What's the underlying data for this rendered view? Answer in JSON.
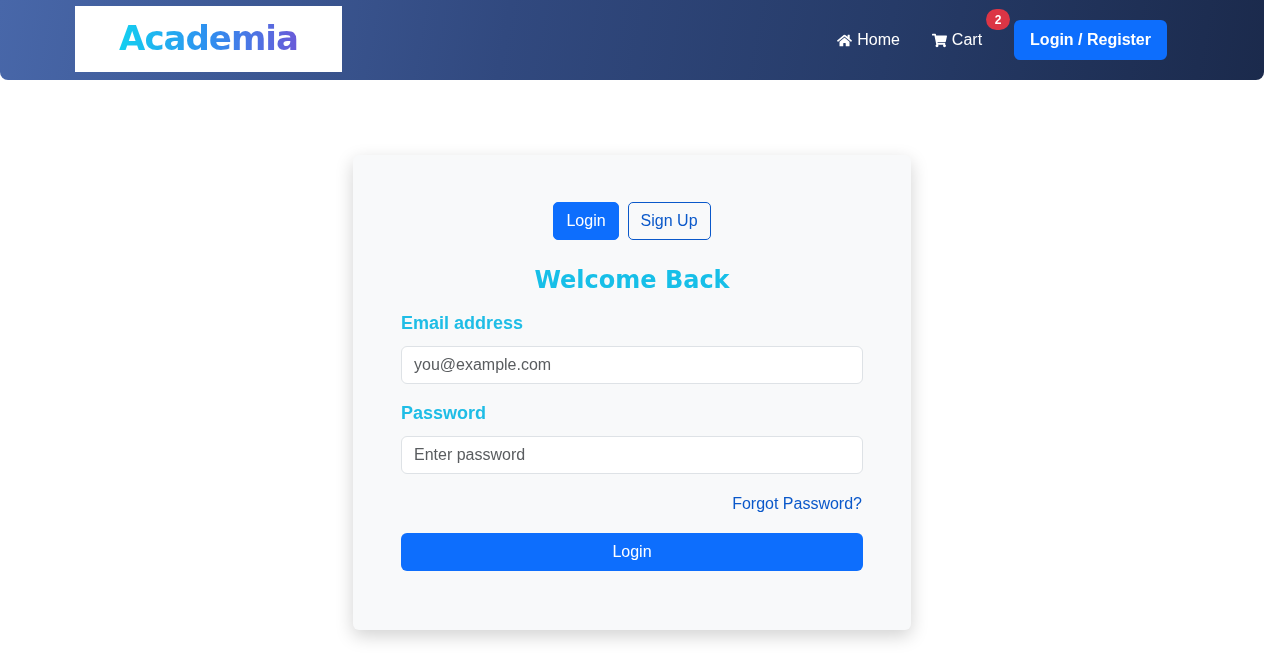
{
  "header": {
    "logo": "Academia",
    "nav": [
      {
        "kind": "home",
        "label": "Home"
      },
      {
        "kind": "cart",
        "label": "Cart",
        "badge": "2"
      }
    ],
    "button": "Login / Register"
  },
  "auth_card": {
    "tabs": [
      {
        "label": "Login",
        "selected": true
      },
      {
        "label": "Sign Up",
        "selected": false
      }
    ],
    "title": "Welcome Back",
    "fields": [
      {
        "label": "Email address",
        "placeholder": "you@example.com"
      },
      {
        "label": "Password",
        "placeholder": "Enter password"
      }
    ],
    "forgot_link": "Forgot Password?",
    "submit": "Login"
  }
}
